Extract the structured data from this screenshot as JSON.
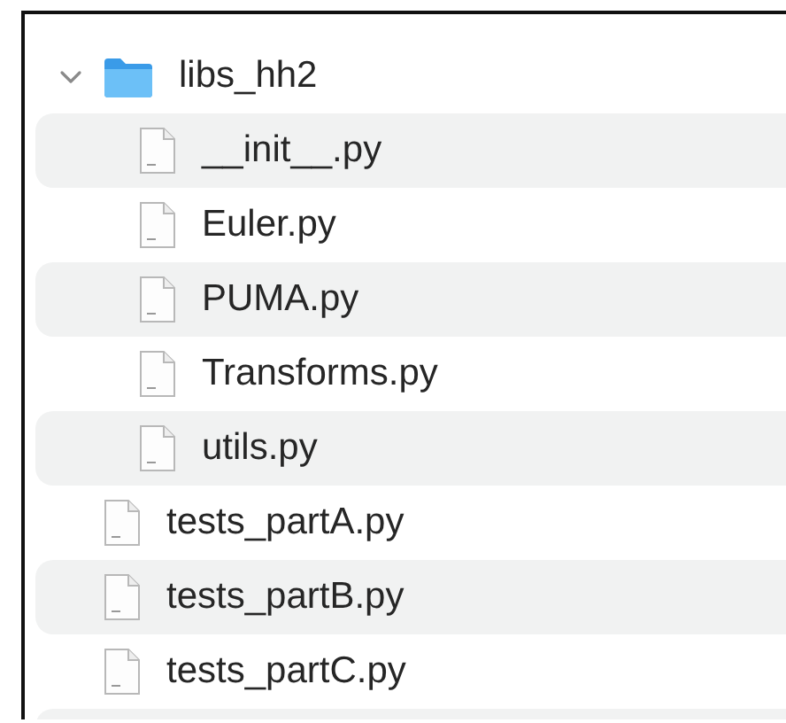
{
  "tree": [
    {
      "kind": "folder",
      "name": "libs_hh2",
      "expanded": true,
      "children": [
        {
          "kind": "file",
          "name": "__init__.py"
        },
        {
          "kind": "file",
          "name": "Euler.py"
        },
        {
          "kind": "file",
          "name": "PUMA.py"
        },
        {
          "kind": "file",
          "name": "Transforms.py"
        },
        {
          "kind": "file",
          "name": "utils.py"
        }
      ]
    },
    {
      "kind": "file",
      "name": "tests_partA.py"
    },
    {
      "kind": "file",
      "name": "tests_partB.py"
    },
    {
      "kind": "file",
      "name": "tests_partC.py"
    }
  ]
}
